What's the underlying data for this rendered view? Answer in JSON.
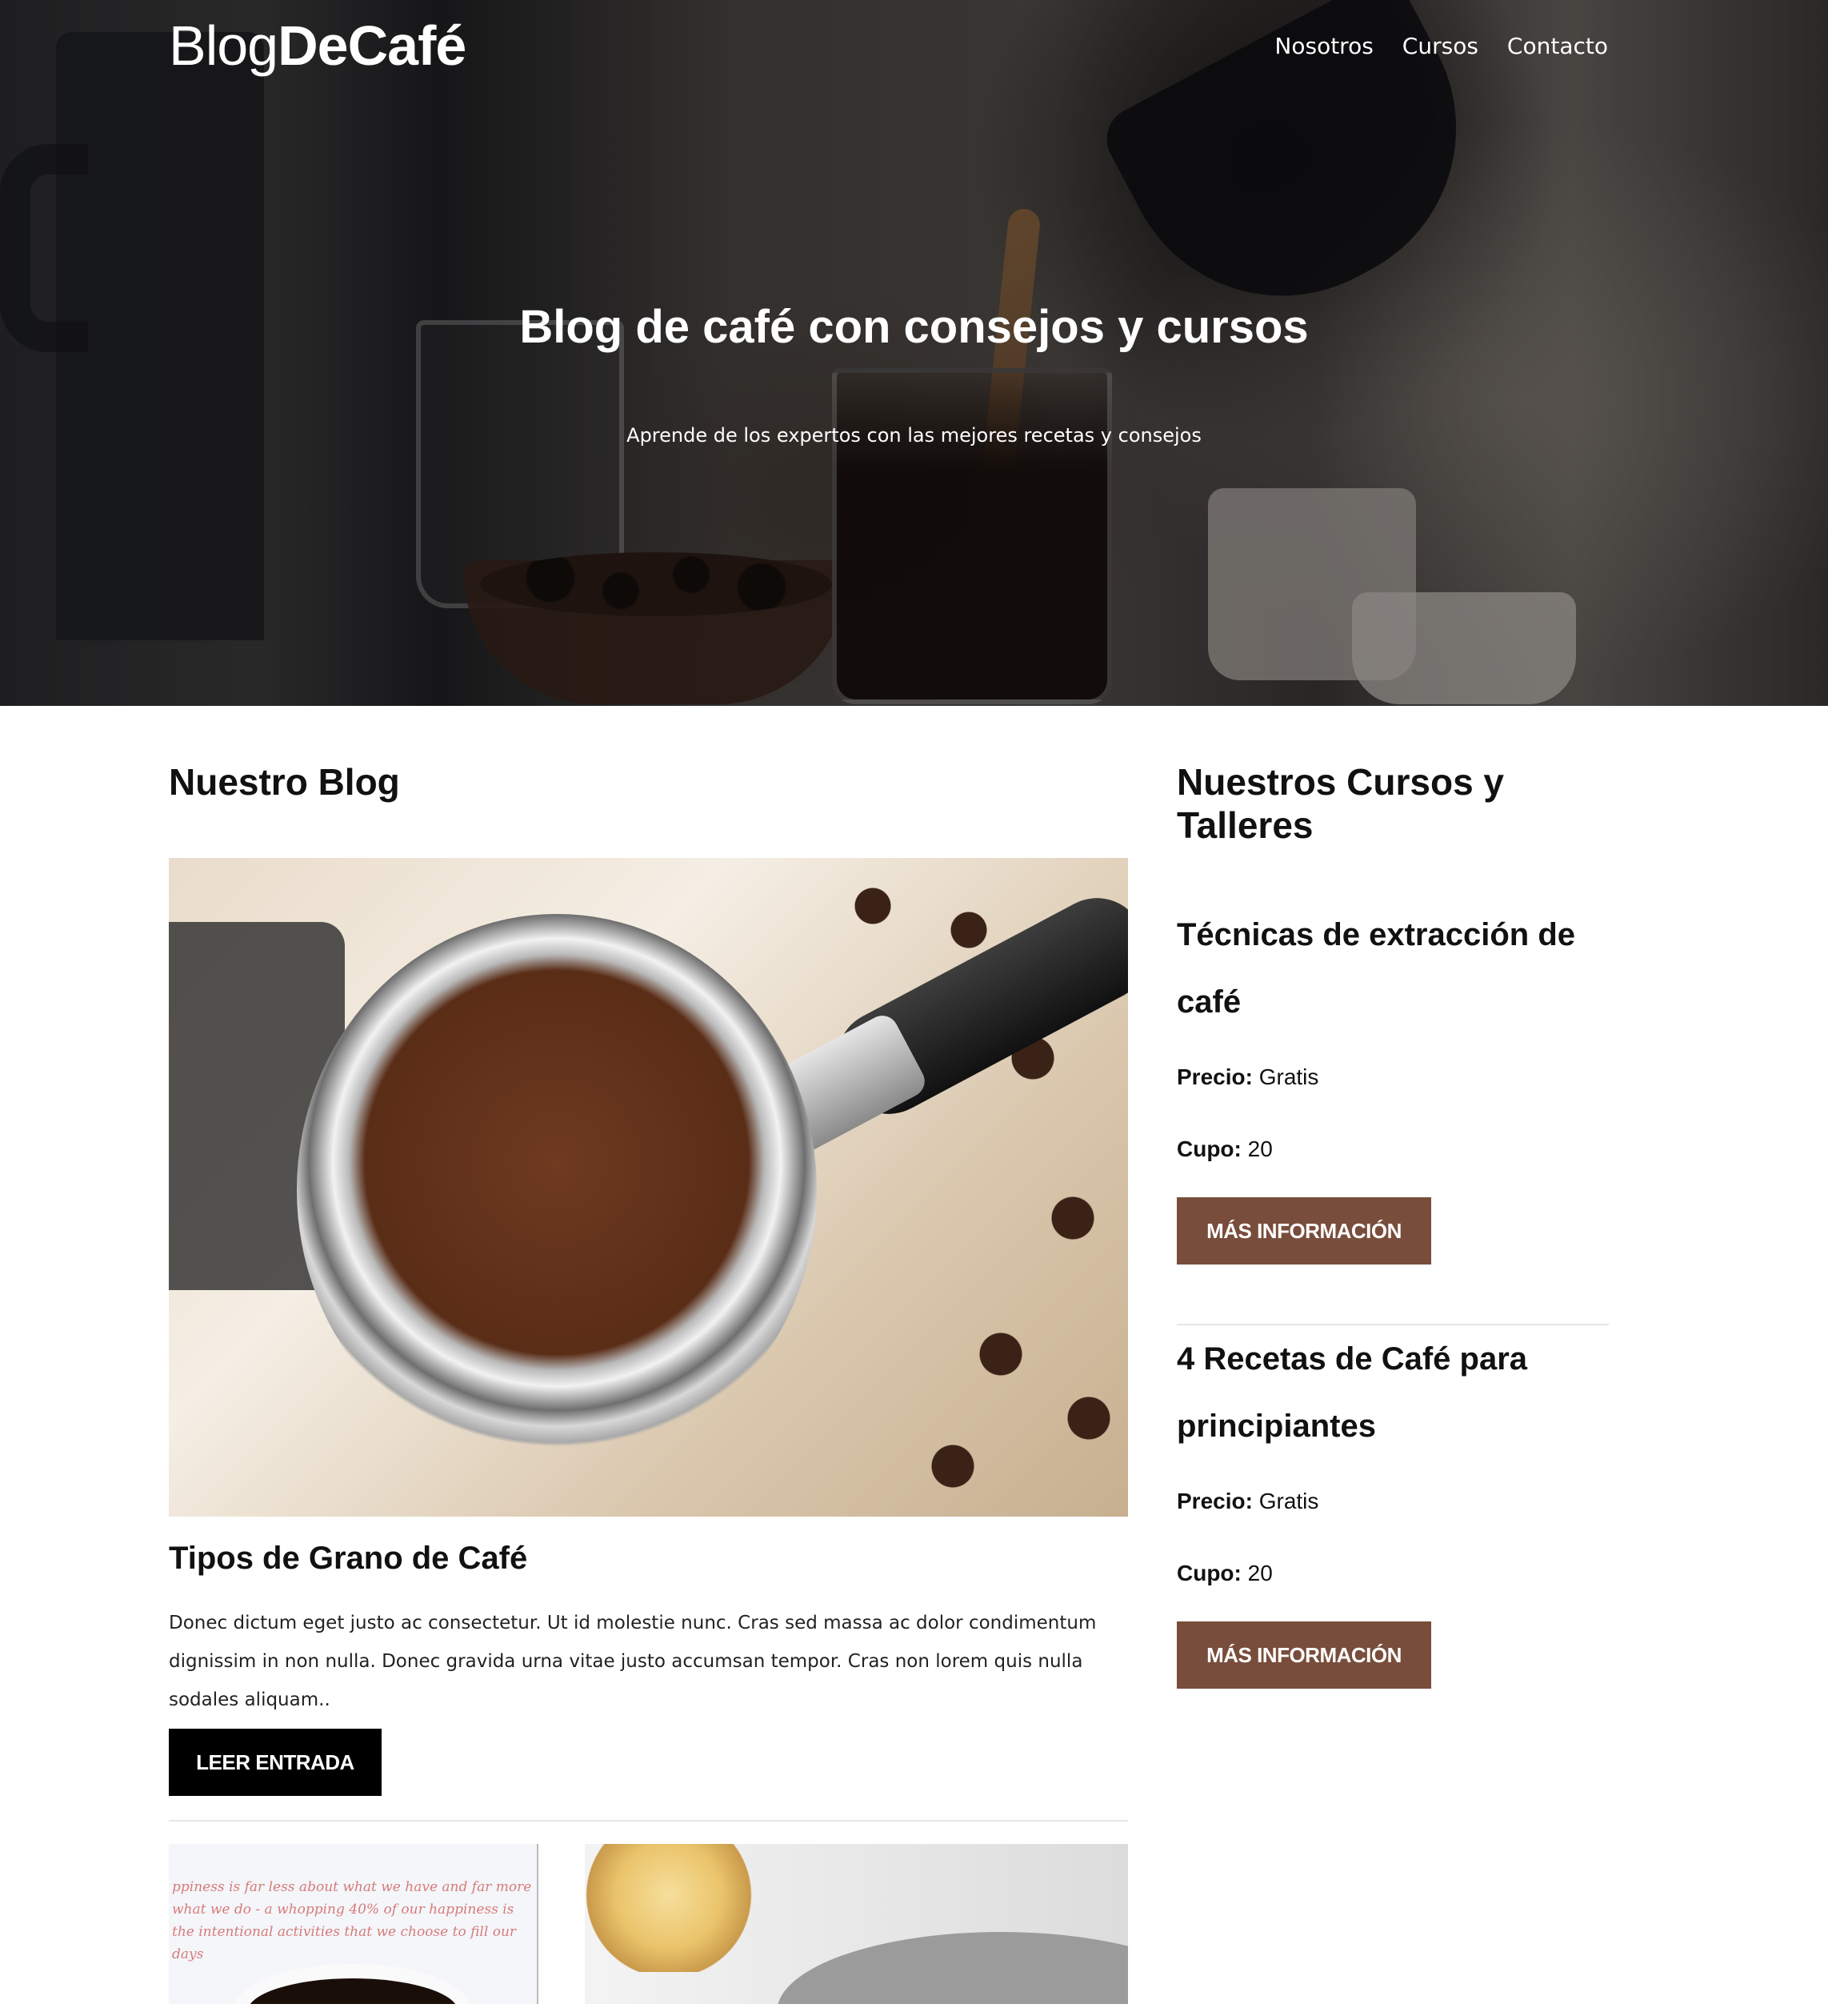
{
  "header": {
    "logo_light": "Blog",
    "logo_bold": "DeCafé",
    "nav": [
      "Nosotros",
      "Cursos",
      "Contacto"
    ]
  },
  "hero": {
    "title": "Blog de café con consejos y cursos",
    "subtitle": "Aprende de los expertos con las mejores recetas y consejos"
  },
  "blog": {
    "section_title": "Nuestro Blog",
    "posts": [
      {
        "title": "Tipos de Grano de Café",
        "excerpt": "Donec dictum eget justo ac consectetur. Ut id molestie nunc. Cras sed massa ac dolor condimentum dignissim in non nulla. Donec gravida urna vitae justo accumsan tempor. Cras non lorem quis nulla sodales aliquam..",
        "button_label": "Leer Entrada"
      }
    ],
    "post2_image_text": "ppiness is far less about what we have and far more what we do - a whopping 40% of our happiness is the intentional activities that we choose to fill our days"
  },
  "courses": {
    "section_title": "Nuestros Cursos y Talleres",
    "price_label": "Precio:",
    "quota_label": "Cupo:",
    "items": [
      {
        "title": "Técnicas de extracción de café",
        "price": "Gratis",
        "quota": "20",
        "button_label": "Más Información"
      },
      {
        "title": "4 Recetas de Café para principiantes",
        "price": "Gratis",
        "quota": "20",
        "button_label": "Más Información"
      }
    ]
  },
  "colors": {
    "accent_brown": "#784d3c",
    "button_black": "#000000"
  }
}
